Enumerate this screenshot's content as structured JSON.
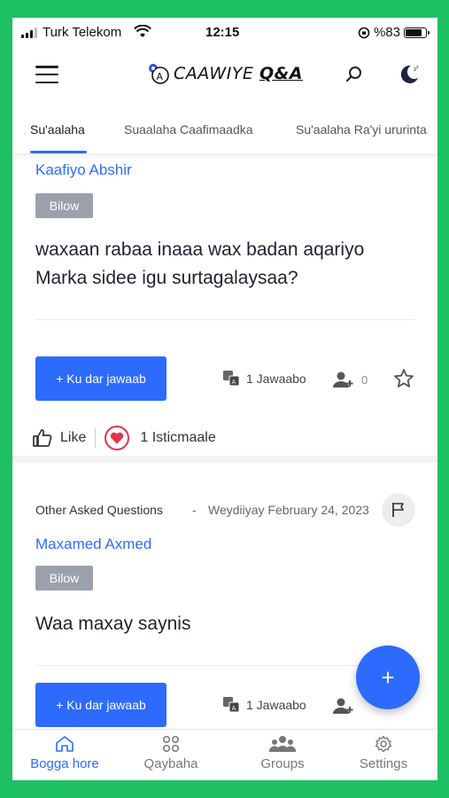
{
  "status_bar": {
    "carrier": "Turk Telekom",
    "time": "12:15",
    "battery_text": "%83",
    "battery_level": 0.83
  },
  "header": {
    "logo_text": "CAAWIYE",
    "logo_qa": "Q&A",
    "icons": [
      "menu-icon",
      "search-icon",
      "moon-icon"
    ]
  },
  "tabs": [
    {
      "label": "Su'aalaha",
      "active": true
    },
    {
      "label": "Suaalaha Caafimaadka",
      "active": false
    },
    {
      "label": "Su'aalaha Ra'yi ururinta",
      "active": false
    }
  ],
  "posts": [
    {
      "author": "Kaafiyo Abshir",
      "badge": "Bilow",
      "question": "waxaan rabaa inaaa wax badan aqariyo Marka sidee igu surtagalaysaa?",
      "answer_button": "+ Ku dar jawaab",
      "answers": "1 Jawaabo",
      "followers": "0",
      "like_label": "Like",
      "reactions": "1 Isticmaale"
    },
    {
      "category": "Other Asked Questions",
      "separator": "-",
      "date": "Weydiiyay February 24, 2023",
      "author": "Maxamed Axmed",
      "badge": "Bilow",
      "question": "Waa maxay saynis",
      "answer_button": "+ Ku dar jawaab",
      "answers": "1 Jawaabo"
    }
  ],
  "fab_label": "+",
  "bottom_nav": [
    {
      "label": "Bogga hore",
      "icon": "home-icon",
      "active": true
    },
    {
      "label": "Qaybaha",
      "icon": "grid-icon",
      "active": false
    },
    {
      "label": "Groups",
      "icon": "group-icon",
      "active": false
    },
    {
      "label": "Settings",
      "icon": "gear-icon",
      "active": false
    }
  ],
  "colors": {
    "accent": "#2d6bff",
    "frame": "#1ec064",
    "badge": "#9aa1ad",
    "heart": "#e5334b"
  }
}
